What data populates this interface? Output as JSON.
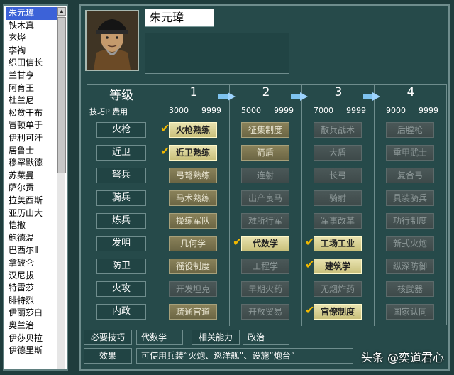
{
  "sidebar": {
    "items": [
      "朱元璋",
      "铁木真",
      "玄烨",
      "李祹",
      "织田信长",
      "兰甘亨",
      "阿育王",
      "杜兰尼",
      "松赞干布",
      "冒顿单于",
      "伊利可汗",
      "居鲁士",
      "穆罕默德",
      "苏莱曼",
      "萨尔贡",
      "拉美西斯",
      "亚历山大",
      "恺撒",
      "鲍德温",
      "巴西尔Ⅱ",
      "拿破仑",
      "汉尼拔",
      "特雷莎",
      "腓特烈",
      "伊丽莎白",
      "奥兰治",
      "伊莎贝拉",
      "伊德里斯"
    ],
    "selected_index": 0,
    "scroll_up": "▲"
  },
  "character": {
    "name": "朱元璋",
    "portrait_icon": "emperor-portrait"
  },
  "table": {
    "level_label": "等级",
    "sub_label": "技巧P  费用",
    "arrow_icon": "arrow-right-icon",
    "levels": [
      {
        "num": "1",
        "p": "3000",
        "cost": "9999"
      },
      {
        "num": "2",
        "p": "5000",
        "cost": "9999"
      },
      {
        "num": "3",
        "p": "7000",
        "cost": "9999"
      },
      {
        "num": "4",
        "p": "9000",
        "cost": "9999"
      }
    ],
    "rows": [
      {
        "label": "火枪",
        "skills": [
          {
            "name": "火枪熟练",
            "state": "learned",
            "check": true
          },
          {
            "name": "征集制度",
            "state": "avail",
            "check": false
          },
          {
            "name": "散兵战术",
            "state": "locked",
            "check": false
          },
          {
            "name": "后膛枪",
            "state": "locked",
            "check": false
          }
        ]
      },
      {
        "label": "近卫",
        "skills": [
          {
            "name": "近卫熟练",
            "state": "learned",
            "check": true
          },
          {
            "name": "箭盾",
            "state": "avail",
            "check": false
          },
          {
            "name": "大盾",
            "state": "locked",
            "check": false
          },
          {
            "name": "重甲武士",
            "state": "locked",
            "check": false
          }
        ]
      },
      {
        "label": "弩兵",
        "skills": [
          {
            "name": "弓弩熟练",
            "state": "avail",
            "check": false
          },
          {
            "name": "连射",
            "state": "locked",
            "check": false
          },
          {
            "name": "长弓",
            "state": "locked",
            "check": false
          },
          {
            "name": "复合弓",
            "state": "locked",
            "check": false
          }
        ]
      },
      {
        "label": "骑兵",
        "skills": [
          {
            "name": "马术熟练",
            "state": "avail",
            "check": false
          },
          {
            "name": "出产良马",
            "state": "locked",
            "check": false
          },
          {
            "name": "骑射",
            "state": "locked",
            "check": false
          },
          {
            "name": "具装骑兵",
            "state": "locked",
            "check": false
          }
        ]
      },
      {
        "label": "炼兵",
        "skills": [
          {
            "name": "操练军队",
            "state": "avail",
            "check": false
          },
          {
            "name": "难所行军",
            "state": "locked",
            "check": false
          },
          {
            "name": "军事改革",
            "state": "locked",
            "check": false
          },
          {
            "name": "功行制度",
            "state": "locked",
            "check": false
          }
        ]
      },
      {
        "label": "发明",
        "skills": [
          {
            "name": "几何学",
            "state": "avail",
            "check": false
          },
          {
            "name": "代数学",
            "state": "learned",
            "check": true
          },
          {
            "name": "工场工业",
            "state": "learned",
            "check": true
          },
          {
            "name": "新式火炮",
            "state": "locked",
            "check": false
          }
        ]
      },
      {
        "label": "防卫",
        "skills": [
          {
            "name": "徭役制度",
            "state": "avail",
            "check": false
          },
          {
            "name": "工程学",
            "state": "locked",
            "check": false
          },
          {
            "name": "建筑学",
            "state": "learned",
            "check": true
          },
          {
            "name": "纵深防御",
            "state": "locked",
            "check": false
          }
        ]
      },
      {
        "label": "火攻",
        "skills": [
          {
            "name": "开发坦克",
            "state": "locked",
            "check": false
          },
          {
            "name": "早期火药",
            "state": "locked",
            "check": false
          },
          {
            "name": "无烟炸药",
            "state": "locked",
            "check": false
          },
          {
            "name": "核武器",
            "state": "locked",
            "check": false
          }
        ]
      },
      {
        "label": "内政",
        "skills": [
          {
            "name": "疏通官道",
            "state": "avail",
            "check": false
          },
          {
            "name": "开放贸易",
            "state": "locked",
            "check": false
          },
          {
            "name": "官僚制度",
            "state": "learned",
            "check": true
          },
          {
            "name": "国家认同",
            "state": "locked",
            "check": false
          }
        ]
      }
    ]
  },
  "footer": {
    "required_label": "必要技巧",
    "required_value": "代数学",
    "related_label": "相关能力",
    "related_value": "政治",
    "effect_label": "效果",
    "effect_value": "可使用兵装“火炮、巡洋舰”、设施“炮台”"
  },
  "watermark": "头条 @奕道君心",
  "colors": {
    "background": "#1f3d3d",
    "learned": "#d9d29a",
    "available": "#7b7450",
    "locked": "#455252",
    "check": "#f2b800",
    "selected": "#3c62d8"
  }
}
